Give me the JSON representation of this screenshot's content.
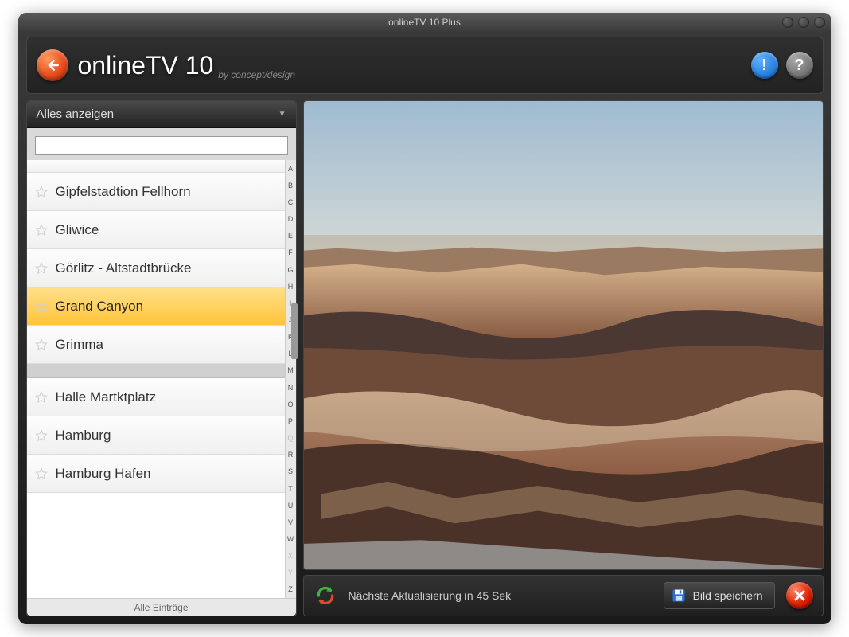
{
  "titlebar": {
    "title": "onlineTV 10 Plus"
  },
  "header": {
    "title": "onlineTV 10",
    "subtitle": "by concept/design"
  },
  "sidebar": {
    "dropdown_label": "Alles anzeigen",
    "search_value": "",
    "items": [
      {
        "label": "Gipfelstadtion Fellhorn",
        "selected": false
      },
      {
        "label": "Gliwice",
        "selected": false
      },
      {
        "label": "Görlitz - Altstadtbrücke",
        "selected": false
      },
      {
        "label": "Grand Canyon",
        "selected": true
      },
      {
        "label": "Grimma",
        "selected": false
      }
    ],
    "items2": [
      {
        "label": "Halle Martktplatz",
        "selected": false
      },
      {
        "label": "Hamburg",
        "selected": false
      },
      {
        "label": "Hamburg Hafen",
        "selected": false
      }
    ],
    "alpha": [
      "A",
      "B",
      "C",
      "D",
      "E",
      "F",
      "G",
      "H",
      "I",
      "J",
      "K",
      "L",
      "M",
      "N",
      "O",
      "P",
      "Q",
      "R",
      "S",
      "T",
      "U",
      "V",
      "W",
      "X",
      "Y",
      "Z"
    ],
    "footer_label": "Alle Einträge"
  },
  "controls": {
    "status": "Nächste Aktualisierung in 45 Sek",
    "save_label": "Bild speichern"
  }
}
